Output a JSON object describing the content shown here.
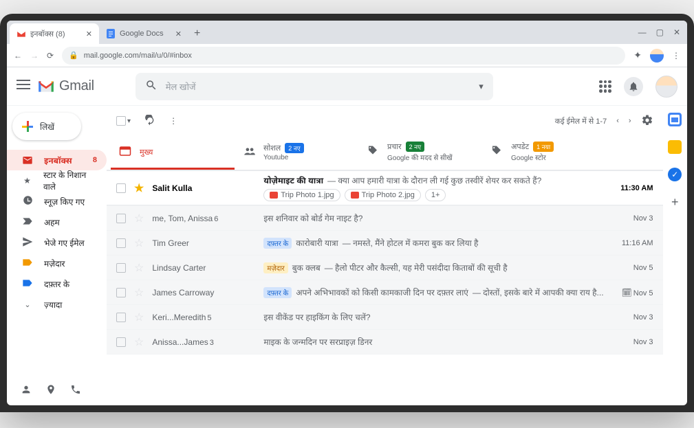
{
  "browser": {
    "tabs": [
      {
        "title": "इनबॉक्स (8)",
        "active": true
      },
      {
        "title": "Google Docs",
        "active": false
      }
    ],
    "url": "mail.google.com/mail/u/0/#inbox"
  },
  "gmail": {
    "brand": "Gmail",
    "search_placeholder": "मेल खोजें",
    "compose": "लिखें",
    "status_text": "कई ईमेल में से 1-7"
  },
  "sidebar": {
    "items": [
      {
        "icon": "inbox",
        "label": "इनबॉक्स",
        "badge": "8",
        "active": true
      },
      {
        "icon": "star",
        "label": "स्टार के निशान वाले"
      },
      {
        "icon": "clock",
        "label": "स्नूज़ किए गए"
      },
      {
        "icon": "important",
        "label": "अहम"
      },
      {
        "icon": "sent",
        "label": "भेजे गए ईमेल"
      },
      {
        "icon": "label-yellow",
        "label": "मज़ेदार"
      },
      {
        "icon": "label-blue",
        "label": "दफ़्तर के"
      },
      {
        "icon": "more",
        "label": "ज़्यादा"
      }
    ]
  },
  "categoryTabs": [
    {
      "icon": "primary",
      "label": "मुख्य",
      "active": true
    },
    {
      "icon": "social",
      "label": "सोशल",
      "chip": "2 नए",
      "chipColor": "blue",
      "sub": "Youtube"
    },
    {
      "icon": "promo",
      "label": "प्रचार",
      "chip": "2 नए",
      "chipColor": "green",
      "sub": "Google की मदद से सीखें"
    },
    {
      "icon": "updates",
      "label": "अपडेट",
      "chip": "1 नया",
      "chipColor": "orange",
      "sub": "Google स्टोर"
    }
  ],
  "emails": [
    {
      "unread": true,
      "starred": true,
      "sender": "Salit Kulla",
      "subject": "योज़ेमाइट की यात्रा",
      "snippet": "क्या आप हमारी यात्रा के दौरान ली गई कुछ तस्वीरें शेयर कर सकते हैं?",
      "attachments": [
        "Trip Photo 1.jpg",
        "Trip Photo 2.jpg",
        "1+"
      ],
      "date": "11:30 AM"
    },
    {
      "unread": false,
      "sender": "me, Tom, Anissa",
      "senderCount": "6",
      "subject": "इस शनिवार को बोर्ड गेम नाइट है?",
      "date": "Nov 3"
    },
    {
      "unread": false,
      "sender": "Tim Greer",
      "labelChip": "दफ़्तर के",
      "labelColor": "blue",
      "subject": "कारोबारी यात्रा",
      "snippet": "नमस्ते, मैंने होटल में कमरा बुक कर लिया है",
      "date": "11:16 AM"
    },
    {
      "unread": false,
      "sender": "Lindsay Carter",
      "labelChip": "मज़ेदार",
      "labelColor": "yellow",
      "subject": "बुक क्लब",
      "snippet": "हैलो पीटर और कैल्सी, यह मेरी पसंदीदा किताबों की सूची है",
      "date": "Nov 5"
    },
    {
      "unread": false,
      "sender": "James Carroway",
      "labelChip": "दफ़्तर के",
      "labelColor": "blue",
      "subject": "अपने अभिभावकों को किसी कामकाजी दिन पर दफ़्तर लाएं",
      "snippet": "दोस्तों, इसके बारे में आपकी क्या राय है...",
      "hasCal": true,
      "date": "Nov 5"
    },
    {
      "unread": false,
      "sender": "Keri...Meredith",
      "senderCount": "5",
      "subject": "इस वीकेंड पर हाइकिंग के लिए चलें?",
      "date": "Nov 3"
    },
    {
      "unread": false,
      "sender": "Anissa...James",
      "senderCount": "3",
      "subject": "माइक के जन्मदिन पर सरप्राइज़ डिनर",
      "date": "Nov 3"
    }
  ]
}
